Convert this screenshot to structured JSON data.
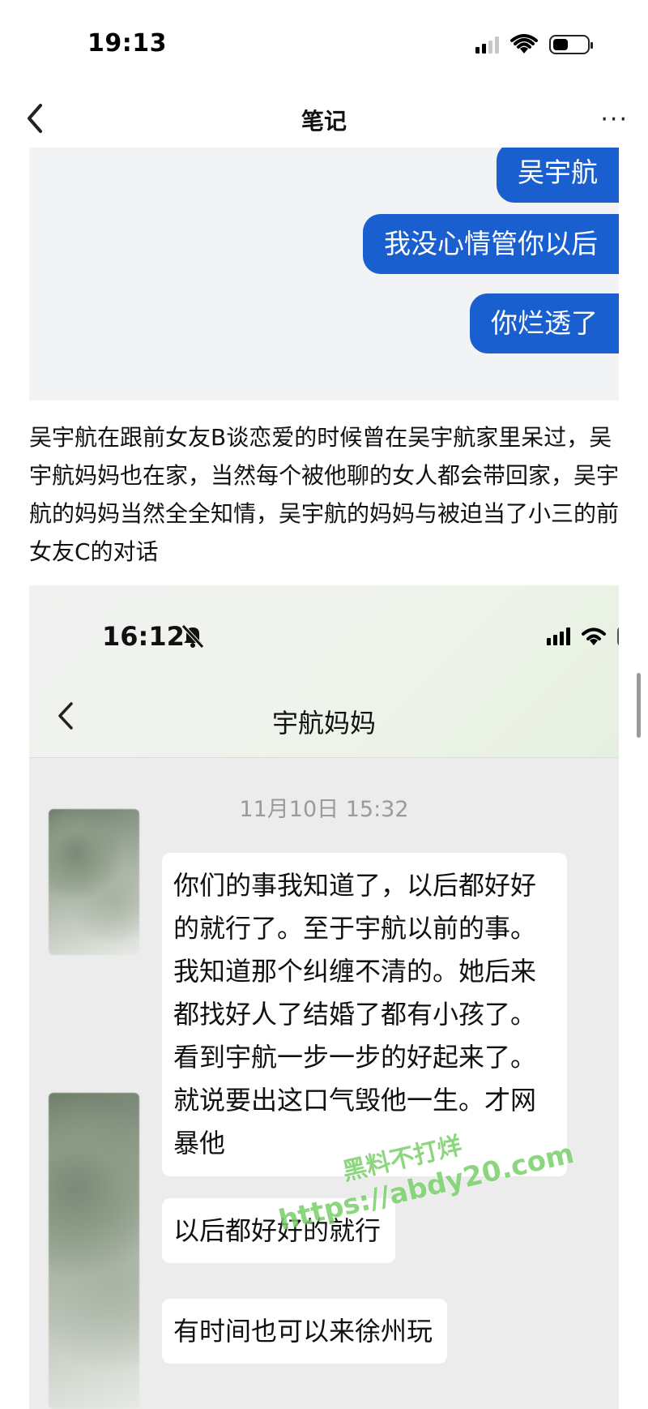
{
  "status_bar": {
    "time": "19:13",
    "battery_level": 0.45
  },
  "nav": {
    "title": "笔记",
    "more": "···"
  },
  "shot1": {
    "bubbles": [
      "吴宇航",
      "我没心情管你以后",
      "你烂透了"
    ]
  },
  "note": {
    "paragraph": "吴宇航在跟前女友B谈恋爱的时候曾在吴宇航家里呆过，吴宇航妈妈也在家，当然每个被他聊的女人都会带回家，吴宇航的妈妈当然全全知情，吴宇航的妈妈与被迫当了小三的前女友C的对话"
  },
  "shot2": {
    "time": "16:12",
    "title": "宇航妈妈",
    "date": "11月10日 15:32",
    "messages": [
      "你们的事我知道了，以后都好好的就行了。至于宇航以前的事。我知道那个纠缠不清的。她后来都找好人了结婚了都有小孩了。看到宇航一步一步的好起来了。就说要出这口气毁他一生。才网暴他",
      "以后都好好的就行",
      "有时间也可以来徐州玩"
    ]
  },
  "watermark": {
    "line1": "黑料不打烊",
    "line2": "https://abdy20.com"
  },
  "colors": {
    "bubble_blue": "#1a5fd0",
    "watermark_green": "#7ad06a"
  }
}
